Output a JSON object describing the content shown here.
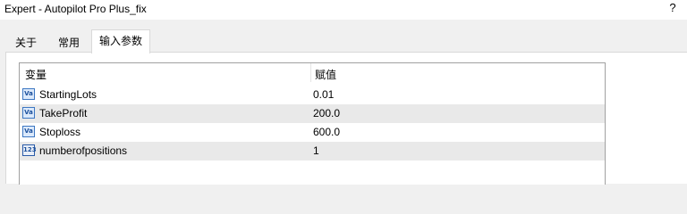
{
  "window": {
    "title": "Expert - Autopilot Pro Plus_fix",
    "help_label": "?"
  },
  "tabs": [
    {
      "label": "关于",
      "active": false
    },
    {
      "label": "常用",
      "active": false
    },
    {
      "label": "输入参数",
      "active": true
    }
  ],
  "table": {
    "headers": {
      "variable": "变量",
      "value": "赋值"
    },
    "rows": [
      {
        "icon": "double-value-icon",
        "icon_text": "Va",
        "name": "StartingLots",
        "value": "0.01"
      },
      {
        "icon": "double-value-icon",
        "icon_text": "Va",
        "name": "TakeProfit",
        "value": "200.0"
      },
      {
        "icon": "double-value-icon",
        "icon_text": "Va",
        "name": "Stoploss",
        "value": "600.0"
      },
      {
        "icon": "integer-value-icon",
        "icon_text": "123",
        "name": "numberofpositions",
        "value": "1"
      }
    ]
  }
}
